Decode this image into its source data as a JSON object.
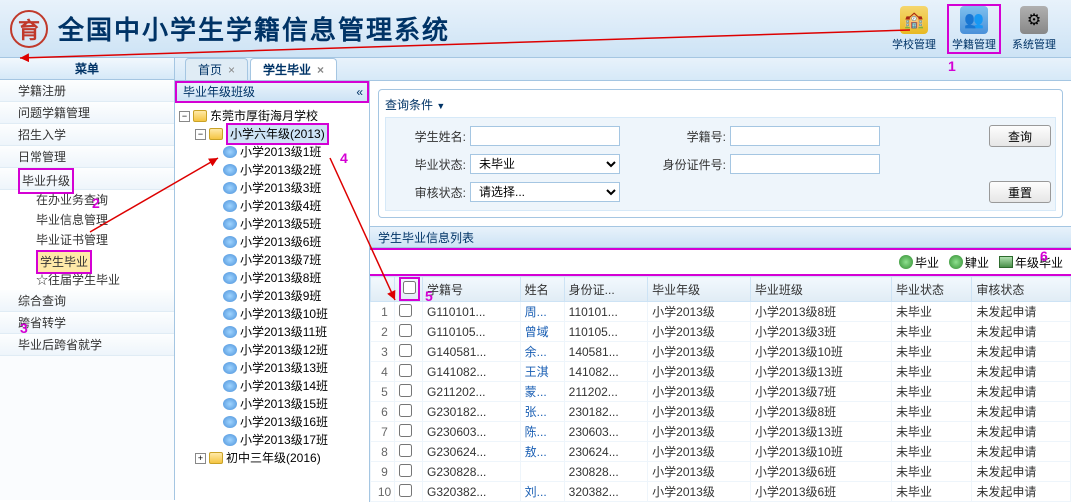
{
  "header": {
    "title": "全国中小学生学籍信息管理系统",
    "nav": [
      "学校管理",
      "学籍管理",
      "系统管理"
    ]
  },
  "sidebar": {
    "title": "菜单",
    "items": [
      "学籍注册",
      "问题学籍管理",
      "招生入学",
      "日常管理",
      "毕业升级",
      "综合查询",
      "跨省转学",
      "毕业后跨省就学"
    ],
    "sub1": [
      "在办业务查询",
      "毕业信息管理",
      "毕业证书管理",
      "学生毕业",
      "☆往届学生毕业"
    ]
  },
  "tabs": [
    "首页",
    "学生毕业"
  ],
  "treeTitle": "毕业年级班级",
  "tree": {
    "root": "东莞市厚街海月学校",
    "grade": "小学六年级(2013)",
    "classes": [
      "小学2013级1班",
      "小学2013级2班",
      "小学2013级3班",
      "小学2013级4班",
      "小学2013级5班",
      "小学2013级6班",
      "小学2013级7班",
      "小学2013级8班",
      "小学2013级9班",
      "小学2013级10班",
      "小学2013级11班",
      "小学2013级12班",
      "小学2013级13班",
      "小学2013级14班",
      "小学2013级15班",
      "小学2013级16班",
      "小学2013级17班"
    ],
    "grade2": "初中三年级(2016)"
  },
  "search": {
    "title": "查询条件",
    "l_name": "学生姓名:",
    "l_code": "学籍号:",
    "l_gstat": "毕业状态:",
    "l_id": "身份证件号:",
    "l_astat": "审核状态:",
    "v_gstat": "未毕业",
    "v_astat": "请选择...",
    "btn_q": "查询",
    "btn_r": "重置"
  },
  "listTitle": "学生毕业信息列表",
  "toolbar": {
    "a": "毕业",
    "b": "肄业",
    "c": "年级毕业"
  },
  "cols": [
    "",
    "",
    "学籍号",
    "姓名",
    "身份证...",
    "毕业年级",
    "毕业班级",
    "毕业状态",
    "审核状态"
  ],
  "rows": [
    [
      "1",
      "G110101...",
      "周...",
      "110101...",
      "小学2013级",
      "小学2013级8班",
      "未毕业",
      "未发起申请"
    ],
    [
      "2",
      "G110105...",
      "曾域",
      "110105...",
      "小学2013级",
      "小学2013级3班",
      "未毕业",
      "未发起申请"
    ],
    [
      "3",
      "G140581...",
      "余...",
      "140581...",
      "小学2013级",
      "小学2013级10班",
      "未毕业",
      "未发起申请"
    ],
    [
      "4",
      "G141082...",
      "王淇",
      "141082...",
      "小学2013级",
      "小学2013级13班",
      "未毕业",
      "未发起申请"
    ],
    [
      "5",
      "G211202...",
      "蒙...",
      "211202...",
      "小学2013级",
      "小学2013级7班",
      "未毕业",
      "未发起申请"
    ],
    [
      "6",
      "G230182...",
      "张...",
      "230182...",
      "小学2013级",
      "小学2013级8班",
      "未毕业",
      "未发起申请"
    ],
    [
      "7",
      "G230603...",
      "陈...",
      "230603...",
      "小学2013级",
      "小学2013级13班",
      "未毕业",
      "未发起申请"
    ],
    [
      "8",
      "G230624...",
      "敖...",
      "230624...",
      "小学2013级",
      "小学2013级10班",
      "未毕业",
      "未发起申请"
    ],
    [
      "9",
      "G230828...",
      "",
      "230828...",
      "小学2013级",
      "小学2013级6班",
      "未毕业",
      "未发起申请"
    ],
    [
      "10",
      "G320382...",
      "刘...",
      "320382...",
      "小学2013级",
      "小学2013级6班",
      "未毕业",
      "未发起申请"
    ]
  ],
  "annot": {
    "n1": "1",
    "n2": "2",
    "n3": "3",
    "n4": "4",
    "n5": "5",
    "n6": "6"
  }
}
